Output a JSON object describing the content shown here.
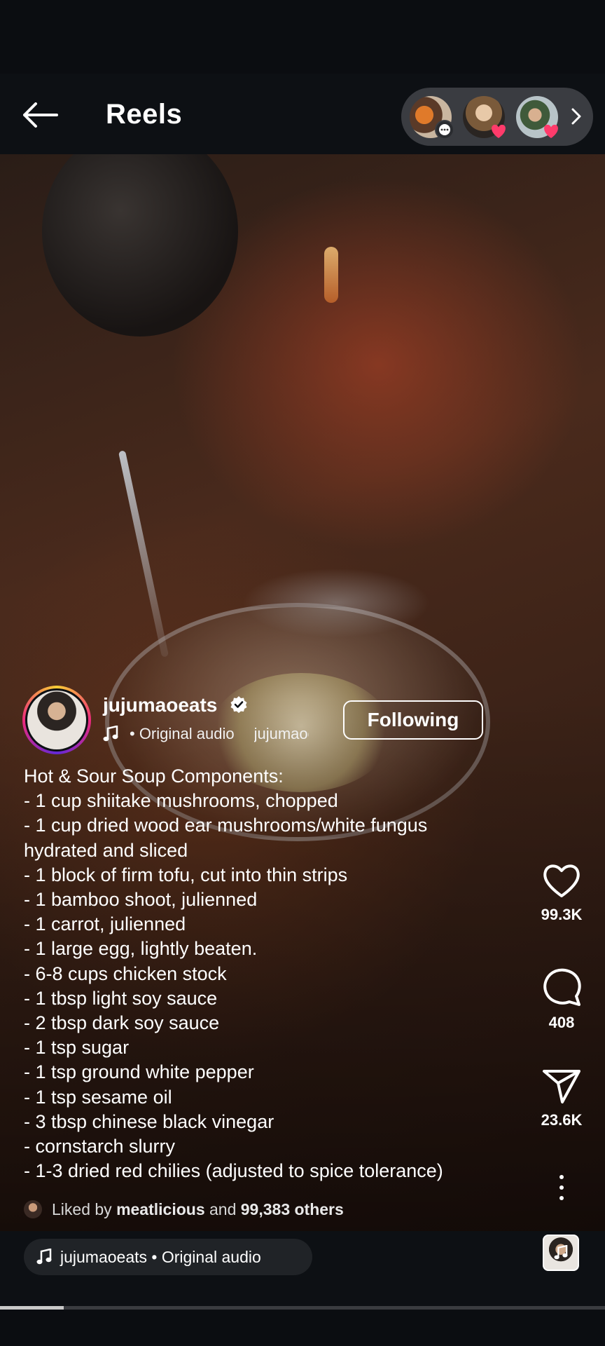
{
  "header": {
    "title": "Reels"
  },
  "friends_pill": {
    "avatars": [
      {
        "badge": "comment"
      },
      {
        "badge": "heart"
      },
      {
        "badge": "heart"
      }
    ]
  },
  "author": {
    "username": "jujumaoeats",
    "verified": true,
    "audio_label": "• Original audio",
    "audio_scroll": "jujumaoeats",
    "follow_label": "Following"
  },
  "caption": {
    "lines": [
      "Hot & Sour Soup Components:",
      "- 1 cup shiitake mushrooms, chopped",
      "- 1 cup dried wood ear mushrooms/white fungus",
      "hydrated and sliced",
      "- 1 block of firm tofu, cut into thin strips",
      "- 1 bamboo shoot, julienned",
      "- 1 carrot, julienned",
      "- 1 large egg, lightly beaten.",
      "- 6-8 cups chicken stock",
      "- 1 tbsp light soy sauce",
      "- 2 tbsp dark soy sauce",
      "- 1 tsp sugar",
      "- 1 tsp ground white pepper",
      "- 1 tsp sesame oil",
      "- 3 tbsp chinese black vinegar",
      "- cornstarch slurry",
      "- 1-3 dried red chilies (adjusted to spice tolerance)"
    ]
  },
  "actions": {
    "likes": "99.3K",
    "comments": "408",
    "shares": "23.6K"
  },
  "liked_by": {
    "prefix": "Liked by",
    "user": "meatlicious",
    "middle": "and",
    "others": "99,383 others"
  },
  "bottom": {
    "audio_pill": "jujumaoeats • Original audio",
    "progress": 0.105
  },
  "colors": {
    "background": "#0b0d11",
    "heart_badge": "#ff3b6b"
  }
}
